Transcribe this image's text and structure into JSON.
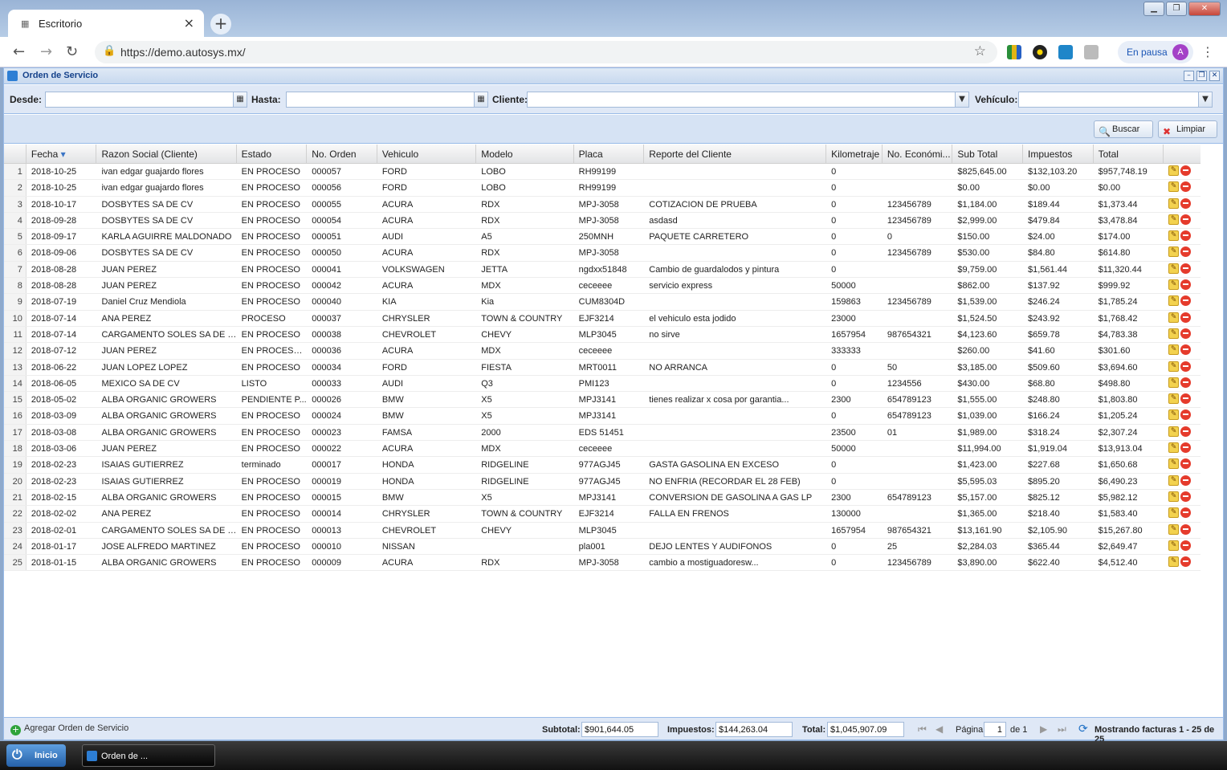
{
  "browser": {
    "tab_title": "Escritorio",
    "url": "https://demo.autosys.mx/",
    "profile_status": "En pausa",
    "profile_initial": "A"
  },
  "window": {
    "title": "Orden de Servicio"
  },
  "filters": {
    "desde_label": "Desde:",
    "hasta_label": "Hasta:",
    "cliente_label": "Cliente:",
    "vehiculo_label": "Vehículo:"
  },
  "actions": {
    "buscar": "Buscar",
    "limpiar": "Limpiar"
  },
  "table": {
    "columns": [
      "Fecha",
      "Razon Social (Cliente)",
      "Estado",
      "No. Orden",
      "Vehiculo",
      "Modelo",
      "Placa",
      "Reporte del Cliente",
      "Kilometraje",
      "No. Económi...",
      "Sub Total",
      "Impuestos",
      "Total"
    ],
    "rows": [
      [
        "1",
        "2018-10-25",
        "ivan edgar guajardo flores",
        "EN PROCESO",
        "000057",
        "FORD",
        "LOBO",
        "RH99199",
        "",
        "0",
        "",
        "$825,645.00",
        "$132,103.20",
        "$957,748.19"
      ],
      [
        "2",
        "2018-10-25",
        "ivan edgar guajardo flores",
        "EN PROCESO",
        "000056",
        "FORD",
        "LOBO",
        "RH99199",
        "",
        "0",
        "",
        "$0.00",
        "$0.00",
        "$0.00"
      ],
      [
        "3",
        "2018-10-17",
        "DOSBYTES SA DE CV",
        "EN PROCESO",
        "000055",
        "ACURA",
        "RDX",
        "MPJ-3058",
        "COTIZACION DE PRUEBA",
        "0",
        "123456789",
        "$1,184.00",
        "$189.44",
        "$1,373.44"
      ],
      [
        "4",
        "2018-09-28",
        "DOSBYTES SA DE CV",
        "EN PROCESO",
        "000054",
        "ACURA",
        "RDX",
        "MPJ-3058",
        "asdasd",
        "0",
        "123456789",
        "$2,999.00",
        "$479.84",
        "$3,478.84"
      ],
      [
        "5",
        "2018-09-17",
        "KARLA AGUIRRE MALDONADO",
        "EN PROCESO",
        "000051",
        "AUDI",
        "A5",
        "250MNH",
        "PAQUETE CARRETERO",
        "0",
        "0",
        "$150.00",
        "$24.00",
        "$174.00"
      ],
      [
        "6",
        "2018-09-06",
        "DOSBYTES SA DE CV",
        "EN PROCESO",
        "000050",
        "ACURA",
        "RDX",
        "MPJ-3058",
        "",
        "0",
        "123456789",
        "$530.00",
        "$84.80",
        "$614.80"
      ],
      [
        "7",
        "2018-08-28",
        "JUAN PEREZ",
        "EN PROCESO",
        "000041",
        "VOLKSWAGEN",
        "JETTA",
        "ngdxx51848",
        "Cambio de guardalodos y pintura",
        "0",
        "",
        "$9,759.00",
        "$1,561.44",
        "$11,320.44"
      ],
      [
        "8",
        "2018-08-28",
        "JUAN PEREZ",
        "EN PROCESO",
        "000042",
        "ACURA",
        "MDX",
        "ceceeee",
        "servicio express",
        "50000",
        "",
        "$862.00",
        "$137.92",
        "$999.92"
      ],
      [
        "9",
        "2018-07-19",
        "Daniel Cruz Mendiola",
        "EN PROCESO",
        "000040",
        "KIA",
        "Kia",
        "CUM8304D",
        "",
        "159863",
        "123456789",
        "$1,539.00",
        "$246.24",
        "$1,785.24"
      ],
      [
        "10",
        "2018-07-14",
        "ANA PEREZ",
        "PROCESO",
        "000037",
        "CHRYSLER",
        "TOWN & COUNTRY",
        "EJF3214",
        "el vehiculo esta jodido",
        "23000",
        "",
        "$1,524.50",
        "$243.92",
        "$1,768.42"
      ],
      [
        "11",
        "2018-07-14",
        "CARGAMENTO SOLES SA DE CV",
        "EN PROCESO",
        "000038",
        "CHEVROLET",
        "CHEVY",
        "MLP3045",
        "no sirve",
        "1657954",
        "987654321",
        "$4,123.60",
        "$659.78",
        "$4,783.38"
      ],
      [
        "12",
        "2018-07-12",
        "JUAN PEREZ",
        "EN PROCESOs...",
        "000036",
        "ACURA",
        "MDX",
        "ceceeee",
        "",
        "333333",
        "",
        "$260.00",
        "$41.60",
        "$301.60"
      ],
      [
        "13",
        "2018-06-22",
        "JUAN LOPEZ LOPEZ",
        "EN PROCESO",
        "000034",
        "FORD",
        "FIESTA",
        "MRT0011",
        "NO ARRANCA",
        "0",
        "50",
        "$3,185.00",
        "$509.60",
        "$3,694.60"
      ],
      [
        "14",
        "2018-06-05",
        "MEXICO SA DE CV",
        "LISTO",
        "000033",
        "AUDI",
        "Q3",
        "PMI123",
        "",
        "0",
        "1234556",
        "$430.00",
        "$68.80",
        "$498.80"
      ],
      [
        "15",
        "2018-05-02",
        "ALBA ORGANIC GROWERS",
        "PENDIENTE P...",
        "000026",
        "BMW",
        "X5",
        "MPJ3141",
        "tienes realizar x cosa por garantia...",
        "2300",
        "654789123",
        "$1,555.00",
        "$248.80",
        "$1,803.80"
      ],
      [
        "16",
        "2018-03-09",
        "ALBA ORGANIC GROWERS",
        "EN PROCESO",
        "000024",
        "BMW",
        "X5",
        "MPJ3141",
        "",
        "0",
        "654789123",
        "$1,039.00",
        "$166.24",
        "$1,205.24"
      ],
      [
        "17",
        "2018-03-08",
        "ALBA ORGANIC GROWERS",
        "EN PROCESO",
        "000023",
        "FAMSA",
        "2000",
        "EDS 51451",
        "",
        "23500",
        "01",
        "$1,989.00",
        "$318.24",
        "$2,307.24"
      ],
      [
        "18",
        "2018-03-06",
        "JUAN PEREZ",
        "EN PROCESO",
        "000022",
        "ACURA",
        "MDX",
        "ceceeee",
        "",
        "50000",
        "",
        "$11,994.00",
        "$1,919.04",
        "$13,913.04"
      ],
      [
        "19",
        "2018-02-23",
        "ISAIAS GUTIERREZ",
        "terminado",
        "000017",
        "HONDA",
        "RIDGELINE",
        "977AGJ45",
        "GASTA GASOLINA EN EXCESO",
        "0",
        "",
        "$1,423.00",
        "$227.68",
        "$1,650.68"
      ],
      [
        "20",
        "2018-02-23",
        "ISAIAS GUTIERREZ",
        "EN PROCESO",
        "000019",
        "HONDA",
        "RIDGELINE",
        "977AGJ45",
        "NO ENFRIA (RECORDAR EL 28 FEB)",
        "0",
        "",
        "$5,595.03",
        "$895.20",
        "$6,490.23"
      ],
      [
        "21",
        "2018-02-15",
        "ALBA ORGANIC GROWERS",
        "EN PROCESO",
        "000015",
        "BMW",
        "X5",
        "MPJ3141",
        "CONVERSION DE GASOLINA A GAS LP",
        "2300",
        "654789123",
        "$5,157.00",
        "$825.12",
        "$5,982.12"
      ],
      [
        "22",
        "2018-02-02",
        "ANA PEREZ",
        "EN PROCESO",
        "000014",
        "CHRYSLER",
        "TOWN & COUNTRY",
        "EJF3214",
        "FALLA EN FRENOS",
        "130000",
        "",
        "$1,365.00",
        "$218.40",
        "$1,583.40"
      ],
      [
        "23",
        "2018-02-01",
        "CARGAMENTO SOLES SA DE CV",
        "EN PROCESO",
        "000013",
        "CHEVROLET",
        "CHEVY",
        "MLP3045",
        "",
        "1657954",
        "987654321",
        "$13,161.90",
        "$2,105.90",
        "$15,267.80"
      ],
      [
        "24",
        "2018-01-17",
        "JOSE ALFREDO MARTINEZ",
        "EN PROCESO",
        "000010",
        "NISSAN",
        "",
        "pla001",
        "DEJO LENTES Y AUDIFONOS",
        "0",
        "25",
        "$2,284.03",
        "$365.44",
        "$2,649.47"
      ],
      [
        "25",
        "2018-01-15",
        "ALBA ORGANIC GROWERS",
        "EN PROCESO",
        "000009",
        "ACURA",
        "RDX",
        "MPJ-3058",
        "cambio a mostiguadoresw...",
        "0",
        "123456789",
        "$3,890.00",
        "$622.40",
        "$4,512.40"
      ]
    ]
  },
  "footer": {
    "add_label": "Agregar Orden de Servicio",
    "subtotal_label": "Subtotal:",
    "subtotal_value": "$901,644.05",
    "impuestos_label": "Impuestos:",
    "impuestos_value": "$144,263.04",
    "total_label": "Total:",
    "total_value": "$1,045,907.09",
    "pagina_label": "Página",
    "pagina_value": "1",
    "de_label": "de 1",
    "status": "Mostrando facturas 1 - 25 de 25"
  },
  "taskbar": {
    "start": "Inicio",
    "item": "Orden de ..."
  }
}
